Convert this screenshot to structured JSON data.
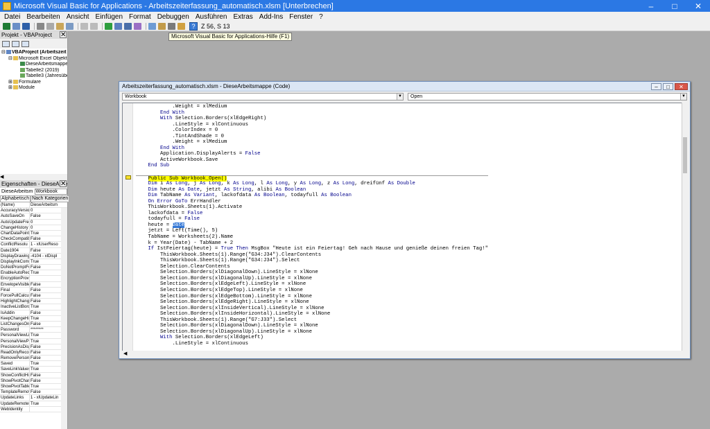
{
  "window": {
    "title": "Microsoft Visual Basic for Applications - Arbeitszeiterfassung_automatisch.xlsm [Unterbrechen]",
    "minimize": "–",
    "maximize": "□",
    "close": "✕"
  },
  "menu": [
    "Datei",
    "Bearbeiten",
    "Ansicht",
    "Einfügen",
    "Format",
    "Debuggen",
    "Ausführen",
    "Extras",
    "Add-Ins",
    "Fenster",
    "?"
  ],
  "toolbar": {
    "position": "Z 56, S 13",
    "help_label": "?",
    "tooltip": "Microsoft Visual Basic for Applications-Hilfe (F1)"
  },
  "project": {
    "title": "Projekt - VBAProject",
    "close": "✕",
    "tree": [
      {
        "label": "VBAProject (Arbeitszeit",
        "indent": 0,
        "expander": "⊟",
        "icon": "vba-project-icon"
      },
      {
        "label": "Microsoft Excel Objekte",
        "indent": 1,
        "expander": "⊟",
        "icon": "folder-icon"
      },
      {
        "label": "DieseArbeitsmappe",
        "indent": 2,
        "expander": "",
        "icon": "workbook-icon"
      },
      {
        "label": "Tabelle2 (2019)",
        "indent": 2,
        "expander": "",
        "icon": "sheet-icon"
      },
      {
        "label": "Tabelle3 (Jahresübe",
        "indent": 2,
        "expander": "",
        "icon": "sheet-icon"
      },
      {
        "label": "Formulare",
        "indent": 1,
        "expander": "⊞",
        "icon": "folder-icon"
      },
      {
        "label": "Module",
        "indent": 1,
        "expander": "⊞",
        "icon": "folder-icon"
      }
    ]
  },
  "properties": {
    "title": "Eigenschaften - DieseArbeitsm",
    "close": "✕",
    "object_label": "DieseArbeitsm",
    "object_value": "Workbook",
    "tab_alpha": "Alphabetisch",
    "tab_cat": "Nach Kategorien",
    "rows": [
      [
        "(Name)",
        "DieseArbeitsm"
      ],
      [
        "AccuracyVersion",
        "0"
      ],
      [
        "AutoSaveOn",
        "False"
      ],
      [
        "AutoUpdateFre",
        "0"
      ],
      [
        "ChangeHistory",
        "0"
      ],
      [
        "ChartDataPoint",
        "True"
      ],
      [
        "CheckCompatib",
        "False"
      ],
      [
        "ConflictResolu",
        "1 - xlUserReso"
      ],
      [
        "Date1904",
        "False"
      ],
      [
        "DisplayDrawing",
        "-4104 - xlDispl"
      ],
      [
        "DisplayInkComr",
        "True"
      ],
      [
        "DoNotPromptFo",
        "False"
      ],
      [
        "EnableAutoRec",
        "True"
      ],
      [
        "EncryptionProvi",
        ""
      ],
      [
        "EnvelopeVisible",
        "False"
      ],
      [
        "Final",
        "False"
      ],
      [
        "ForcePullCalcula",
        "False"
      ],
      [
        "HighlightChange",
        "False"
      ],
      [
        "InactiveListBord",
        "True"
      ],
      [
        "IsAddin",
        "False"
      ],
      [
        "KeepChangeHis",
        "True"
      ],
      [
        "ListChangesOnI",
        "False"
      ],
      [
        "Password",
        "********"
      ],
      [
        "PersonalViewLis",
        "True"
      ],
      [
        "PersonalViewPri",
        "True"
      ],
      [
        "PrecisionAsDispl",
        "False"
      ],
      [
        "ReadOnlyRecor",
        "False"
      ],
      [
        "RemovePersonal",
        "False"
      ],
      [
        "Saved",
        "True"
      ],
      [
        "SaveLinkValues",
        "True"
      ],
      [
        "ShowConflictHis",
        "False"
      ],
      [
        "ShowPivotChartA",
        "False"
      ],
      [
        "ShowPivotTable",
        "True"
      ],
      [
        "TemplateRemov",
        "False"
      ],
      [
        "UpdateLinks",
        "1 - xlUpdateLin"
      ],
      [
        "UpdateRemoteR",
        "True"
      ],
      [
        "WebIdentity",
        ""
      ]
    ]
  },
  "codewin": {
    "title": "Arbeitszeiterfassung_automatisch.xlsm - DieseArbeitsmappe (Code)",
    "object_combo": "Workbook",
    "proc_combo": "Open",
    "btn_min": "–",
    "btn_max": "□",
    "btn_close": "✕",
    "lines": [
      [
        {
          "t": "            .Weight = xlMedium"
        }
      ],
      [
        {
          "t": "        "
        },
        {
          "t": "End With",
          "c": "kw"
        }
      ],
      [
        {
          "t": "        "
        },
        {
          "t": "With",
          "c": "kw"
        },
        {
          "t": " Selection.Borders(xlEdgeRight)"
        }
      ],
      [
        {
          "t": "            .LineStyle = xlContinuous"
        }
      ],
      [
        {
          "t": "            .ColorIndex = 0"
        }
      ],
      [
        {
          "t": "            .TintAndShade = 0"
        }
      ],
      [
        {
          "t": "            .Weight = xlMedium"
        }
      ],
      [
        {
          "t": "        "
        },
        {
          "t": "End With",
          "c": "kw"
        }
      ],
      [
        {
          "t": "        Application.DisplayAlerts = "
        },
        {
          "t": "False",
          "c": "kw"
        }
      ],
      [
        {
          "t": "        ActiveWorkbook.Save"
        }
      ],
      [
        {
          "t": "    "
        },
        {
          "t": "End Sub",
          "c": "kw"
        }
      ],
      [
        {
          "t": ""
        }
      ],
      [
        {
          "t": "    "
        },
        {
          "t": "Public Sub Workbook_Open()",
          "c": "hl"
        }
      ],
      [
        {
          "t": "    "
        },
        {
          "t": "Dim",
          "c": "kw"
        },
        {
          "t": " i "
        },
        {
          "t": "As Long",
          "c": "kw"
        },
        {
          "t": ", j "
        },
        {
          "t": "As Long",
          "c": "kw"
        },
        {
          "t": ", k "
        },
        {
          "t": "As Long",
          "c": "kw"
        },
        {
          "t": ", l "
        },
        {
          "t": "As Long",
          "c": "kw"
        },
        {
          "t": ", y "
        },
        {
          "t": "As Long",
          "c": "kw"
        },
        {
          "t": ", z "
        },
        {
          "t": "As Long",
          "c": "kw"
        },
        {
          "t": ", dreifünf "
        },
        {
          "t": "As Double",
          "c": "kw"
        }
      ],
      [
        {
          "t": "    "
        },
        {
          "t": "Dim",
          "c": "kw"
        },
        {
          "t": " heute "
        },
        {
          "t": "As Date",
          "c": "kw"
        },
        {
          "t": ", jetzt "
        },
        {
          "t": "As String",
          "c": "kw"
        },
        {
          "t": ", alibi "
        },
        {
          "t": "As Boolean",
          "c": "kw"
        }
      ],
      [
        {
          "t": "    "
        },
        {
          "t": "Dim",
          "c": "kw"
        },
        {
          "t": " TabName "
        },
        {
          "t": "As Variant",
          "c": "kw"
        },
        {
          "t": ", lackofdata "
        },
        {
          "t": "As Boolean",
          "c": "kw"
        },
        {
          "t": ", todayfull "
        },
        {
          "t": "As Boolean",
          "c": "kw"
        }
      ],
      [
        {
          "t": "    "
        },
        {
          "t": "On Error GoTo",
          "c": "kw"
        },
        {
          "t": " ErrHandler"
        }
      ],
      [
        {
          "t": "    ThisWorkbook.Sheets(1).Activate"
        }
      ],
      [
        {
          "t": "    lackofdata = "
        },
        {
          "t": "False",
          "c": "kw"
        }
      ],
      [
        {
          "t": "    todayfull = "
        },
        {
          "t": "False",
          "c": "kw"
        }
      ],
      [
        {
          "t": "    heute = "
        },
        {
          "t": "Date",
          "c": "selw"
        }
      ],
      [
        {
          "t": "    jetzt = Left(Time(), 5)"
        }
      ],
      [
        {
          "t": "    TabName = Worksheets(2).Name"
        }
      ],
      [
        {
          "t": "    k = Year(Date) - TabName + 2"
        }
      ],
      [
        {
          "t": "    "
        },
        {
          "t": "If",
          "c": "kw"
        },
        {
          "t": " IstFeiertag(heute) = "
        },
        {
          "t": "True Then",
          "c": "kw"
        },
        {
          "t": " MsgBox \"Heute ist ein Feiertag! Geh nach Hause und genieße deinen freien Tag!\""
        }
      ],
      [
        {
          "t": "        ThisWorkbook.Sheets(1).Range(\"G34:J34\").ClearContents"
        }
      ],
      [
        {
          "t": "        ThisWorkbook.Sheets(1).Range(\"G34:J34\").Select"
        }
      ],
      [
        {
          "t": "        Selection.ClearContents"
        }
      ],
      [
        {
          "t": "        Selection.Borders(xlDiagonalDown).LineStyle = xlNone"
        }
      ],
      [
        {
          "t": "        Selection.Borders(xlDiagonalUp).LineStyle = xlNone"
        }
      ],
      [
        {
          "t": "        Selection.Borders(xlEdgeLeft).LineStyle = xlNone"
        }
      ],
      [
        {
          "t": "        Selection.Borders(xlEdgeTop).LineStyle = xlNone"
        }
      ],
      [
        {
          "t": "        Selection.Borders(xlEdgeBottom).LineStyle = xlNone"
        }
      ],
      [
        {
          "t": "        Selection.Borders(xlEdgeRight).LineStyle = xlNone"
        }
      ],
      [
        {
          "t": "        Selection.Borders(xlInsideVertical).LineStyle = xlNone"
        }
      ],
      [
        {
          "t": "        Selection.Borders(xlInsideHorizontal).LineStyle = xlNone"
        }
      ],
      [
        {
          "t": "        ThisWorkbook.Sheets(1).Range(\"G7:J33\").Select"
        }
      ],
      [
        {
          "t": "        Selection.Borders(xlDiagonalDown).LineStyle = xlNone"
        }
      ],
      [
        {
          "t": "        Selection.Borders(xlDiagonalUp).LineStyle = xlNone"
        }
      ],
      [
        {
          "t": "        "
        },
        {
          "t": "With",
          "c": "kw"
        },
        {
          "t": " Selection.Borders(xlEdgeLeft)"
        }
      ],
      [
        {
          "t": "            .LineStyle = xlContinuous"
        }
      ]
    ]
  },
  "colors": {
    "titlebar": "#2b78e4",
    "keyword": "#00008b",
    "highlight": "#ffff00",
    "selection": "#3478d6"
  }
}
